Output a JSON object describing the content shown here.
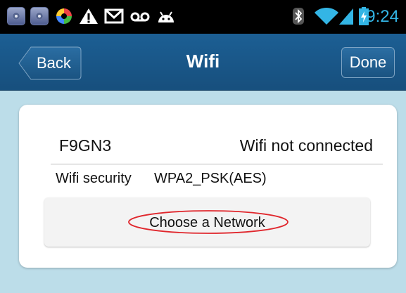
{
  "status_bar": {
    "time": "9:24",
    "icons": [
      "app-icon",
      "app-icon",
      "colorful-app-icon",
      "warning-icon",
      "gmail-icon",
      "voicemail-icon",
      "android-icon",
      "bluetooth-icon",
      "wifi-icon",
      "signal-icon",
      "battery-charging-icon"
    ],
    "time_color": "#33b5e5"
  },
  "navbar": {
    "back_label": "Back",
    "title": "Wifi",
    "done_label": "Done"
  },
  "card": {
    "network_name": "F9GN3",
    "connection_status": "Wifi not connected",
    "security_label": "Wifi security",
    "security_value": "WPA2_PSK(AES)",
    "choose_button_label": "Choose a Network"
  },
  "colors": {
    "background": "#bcdde9",
    "navbar": "#1a5686",
    "highlight": "#e0262c"
  }
}
